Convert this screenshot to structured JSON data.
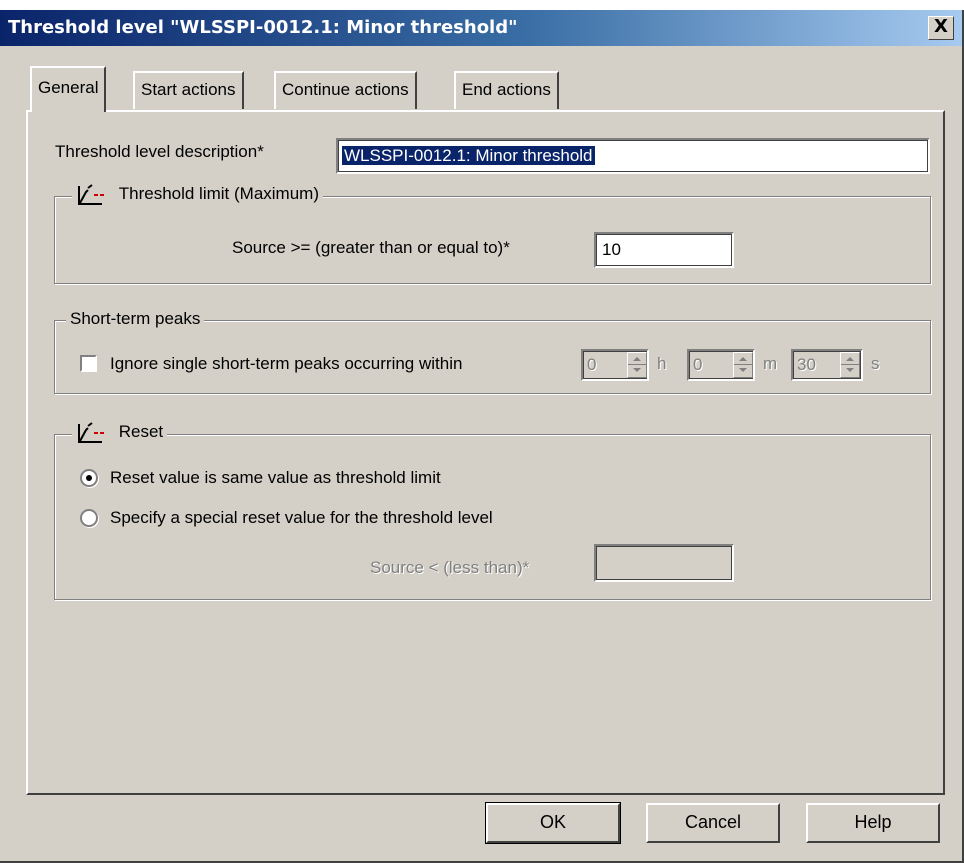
{
  "window": {
    "title": "Threshold level \"WLSSPI-0012.1: Minor threshold\"",
    "close_symbol": "X",
    "close_icon": "close-icon"
  },
  "tabs": [
    {
      "label": "General",
      "active": true
    },
    {
      "label": "Start actions",
      "active": false
    },
    {
      "label": "Continue actions",
      "active": false
    },
    {
      "label": "End actions",
      "active": false
    }
  ],
  "general": {
    "description_label": "Threshold level description*",
    "description_value": "WLSSPI-0012.1: Minor threshold",
    "threshold_group": {
      "title": "Threshold limit (Maximum)",
      "icon": "threshold-graph-icon",
      "source_label": "Source >= (greater than or equal to)*",
      "source_value": "10"
    },
    "peaks_group": {
      "title": "Short-term peaks",
      "checkbox_label": "Ignore single short-term peaks occurring within",
      "checked": false,
      "hours_value": "0",
      "hours_unit": "h",
      "minutes_value": "0",
      "minutes_unit": "m",
      "seconds_value": "30",
      "seconds_unit": "s"
    },
    "reset_group": {
      "title": "Reset",
      "icon": "threshold-graph-icon",
      "option_same": "Reset value is same value as threshold limit",
      "option_special": "Specify a special reset value for the threshold level",
      "selected": "same",
      "source_label": "Source < (less than)*",
      "source_value": ""
    }
  },
  "buttons": {
    "ok": "OK",
    "cancel": "Cancel",
    "help": "Help"
  },
  "colors": {
    "title_start": "#0a246a",
    "title_end": "#a6caf0",
    "face": "#d4d0c8",
    "selection": "#0a246a",
    "icon_red": "#cc0000"
  }
}
